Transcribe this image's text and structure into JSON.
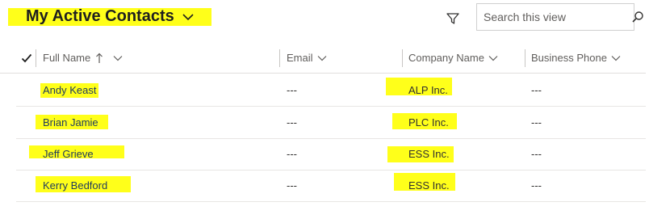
{
  "view": {
    "title": "My Active Contacts"
  },
  "search": {
    "placeholder": "Search this view"
  },
  "columns": [
    {
      "label": "Full Name"
    },
    {
      "label": "Email"
    },
    {
      "label": "Company Name"
    },
    {
      "label": "Business Phone"
    }
  ],
  "rows": [
    {
      "full_name": "Andy Keast",
      "email": "---",
      "company": "ALP Inc.",
      "phone": "---"
    },
    {
      "full_name": "Brian Jamie",
      "email": "---",
      "company": "PLC Inc.",
      "phone": "---"
    },
    {
      "full_name": "Jeff Grieve",
      "email": "---",
      "company": "ESS Inc.",
      "phone": "---"
    },
    {
      "full_name": "Kerry Bedford",
      "email": "---",
      "company": "ESS Inc.",
      "phone": "---"
    }
  ],
  "colors": {
    "highlight": "#ffff1a",
    "border": "#e1dfdd",
    "text": "#323130"
  },
  "icons": [
    "chevron-down-icon",
    "filter-icon",
    "search-icon",
    "checkmark-icon",
    "sort-ascending-icon"
  ]
}
